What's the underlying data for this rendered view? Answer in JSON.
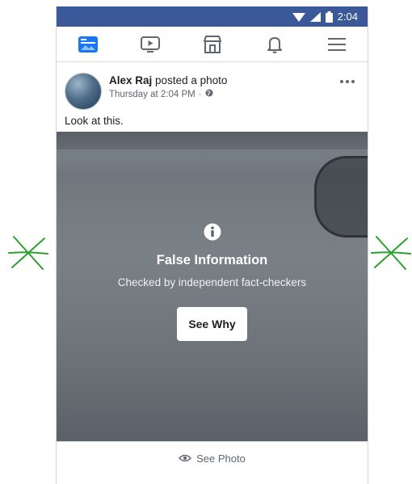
{
  "status_bar": {
    "time": "2:04",
    "icons": [
      "wifi-icon",
      "signal-icon",
      "battery-icon"
    ]
  },
  "nav_bar": {
    "items": [
      "news-feed-icon",
      "watch-icon",
      "marketplace-icon",
      "notifications-bell-icon",
      "menu-hamburger-icon"
    ]
  },
  "post": {
    "author": "Alex Raj",
    "action": "posted a photo",
    "timestamp": "Thursday at 2:04 PM",
    "separator": "·",
    "privacy_icon": "globe-icon",
    "text": "Look at this."
  },
  "fact_check": {
    "title": "False Information",
    "subtitle": "Checked by independent fact-checkers",
    "button_label": "See Why"
  },
  "footer": {
    "label": "See Photo",
    "icon": "eye-icon"
  },
  "colors": {
    "brand": "#3b5998",
    "annotation": "#2e9e2e"
  }
}
